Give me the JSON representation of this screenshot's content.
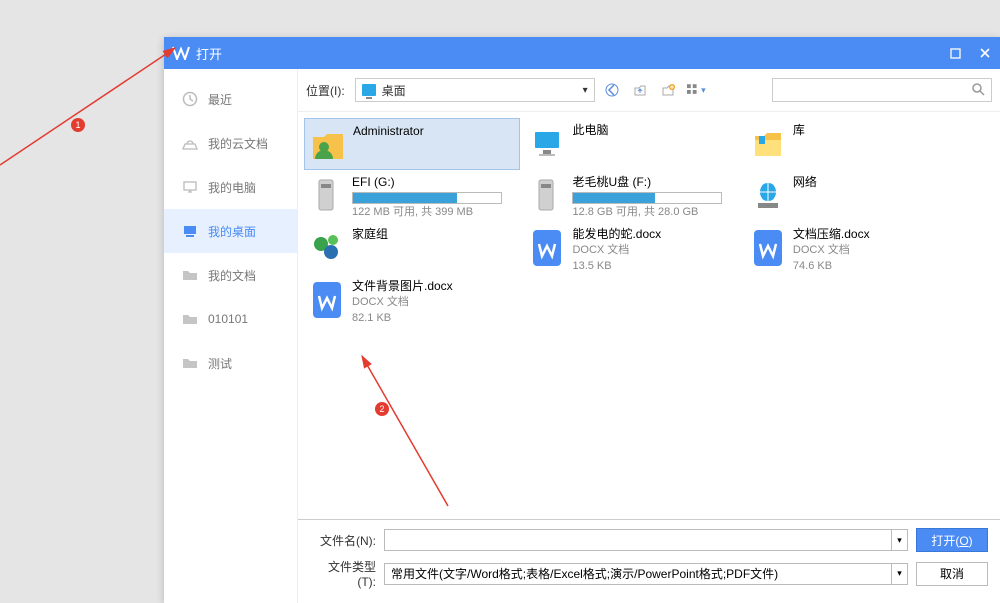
{
  "title": "打开",
  "sidebar": {
    "items": [
      {
        "label": "最近",
        "icon": "clock-icon"
      },
      {
        "label": "我的云文档",
        "icon": "cloud-icon"
      },
      {
        "label": "我的电脑",
        "icon": "monitor-icon"
      },
      {
        "label": "我的桌面",
        "icon": "desktop-icon",
        "active": true
      },
      {
        "label": "我的文档",
        "icon": "folder-icon"
      },
      {
        "label": "010101",
        "icon": "folder-icon"
      },
      {
        "label": "测试",
        "icon": "folder-icon"
      }
    ]
  },
  "toolbar": {
    "location_label": "位置(I):",
    "location_value": "桌面",
    "search_placeholder": ""
  },
  "files": [
    {
      "name": "Administrator",
      "type": "user",
      "selected": true
    },
    {
      "name": "此电脑",
      "type": "pc"
    },
    {
      "name": "库",
      "type": "library"
    },
    {
      "name": "EFI (G:)",
      "type": "drive",
      "sub": "122 MB 可用, 共 399 MB",
      "fill": 70
    },
    {
      "name": "老毛桃U盘 (F:)",
      "type": "drive",
      "sub": "12.8 GB 可用, 共 28.0 GB",
      "fill": 55
    },
    {
      "name": "网络",
      "type": "network"
    },
    {
      "name": "家庭组",
      "type": "homegroup"
    },
    {
      "name": "能发电的蛇.docx",
      "type": "docx",
      "kind": "DOCX 文档",
      "size": "13.5 KB"
    },
    {
      "name": "文档压缩.docx",
      "type": "docx",
      "kind": "DOCX 文档",
      "size": "74.6 KB"
    },
    {
      "name": "文件背景图片.docx",
      "type": "docx",
      "kind": "DOCX 文档",
      "size": "82.1 KB"
    }
  ],
  "bottom": {
    "filename_label": "文件名(N):",
    "filename_value": "",
    "filetype_label": "文件类型(T):",
    "filetype_value": "常用文件(文字/Word格式;表格/Excel格式;演示/PowerPoint格式;PDF文件)",
    "open_label": "打开",
    "open_key": "O",
    "cancel_label": "取消"
  },
  "annotations": {
    "badge1": "1",
    "badge2": "2"
  }
}
